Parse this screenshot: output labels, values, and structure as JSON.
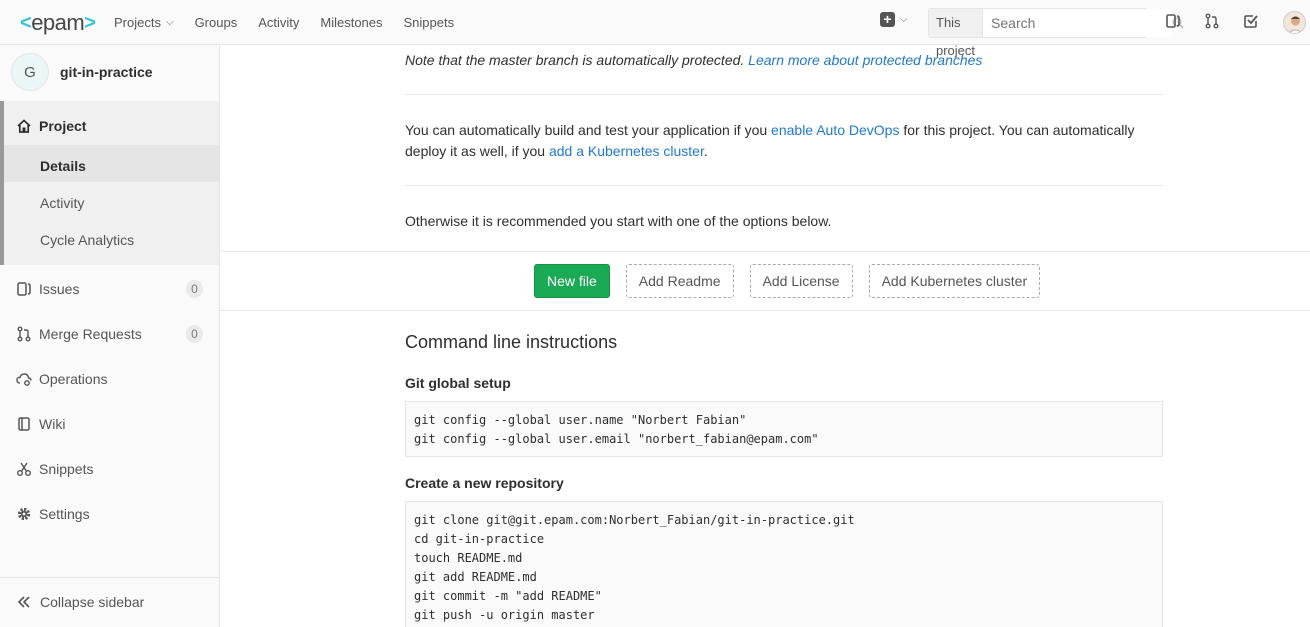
{
  "topbar": {
    "logo": "epam",
    "nav": [
      "Projects",
      "Groups",
      "Activity",
      "Milestones",
      "Snippets"
    ],
    "scope": "This project",
    "search_placeholder": "Search"
  },
  "sidebar": {
    "project_letter": "G",
    "project_name": "git-in-practice",
    "project_label": "Project",
    "sub_items": [
      "Details",
      "Activity",
      "Cycle Analytics"
    ],
    "items": [
      {
        "label": "Issues",
        "badge": "0"
      },
      {
        "label": "Merge Requests",
        "badge": "0"
      },
      {
        "label": "Operations"
      },
      {
        "label": "Wiki"
      },
      {
        "label": "Snippets"
      },
      {
        "label": "Settings"
      }
    ],
    "collapse_label": "Collapse sidebar"
  },
  "main": {
    "protected_note": "Note that the master branch is automatically protected.",
    "protected_link": "Learn more about protected branches",
    "autodevops_pre": "You can automatically build and test your application if you",
    "autodevops_link": "enable Auto DevOps",
    "autodevops_mid": "for this project. You can automatically deploy it as well, if you",
    "k8s_link": "add a Kubernetes cluster",
    "otherwise": "Otherwise it is recommended you start with one of the options below.",
    "buttons": [
      "New file",
      "Add Readme",
      "Add License",
      "Add Kubernetes cluster"
    ],
    "cli_title": "Command line instructions",
    "global_setup_title": "Git global setup",
    "global_setup_code": "git config --global user.name \"Norbert Fabian\"\ngit config --global user.email \"norbert_fabian@epam.com\"",
    "new_repo_title": "Create a new repository",
    "new_repo_code": "git clone git@git.epam.com:Norbert_Fabian/git-in-practice.git\ncd git-in-practice\ntouch README.md\ngit add README.md\ngit commit -m \"add README\"\ngit push -u origin master"
  }
}
